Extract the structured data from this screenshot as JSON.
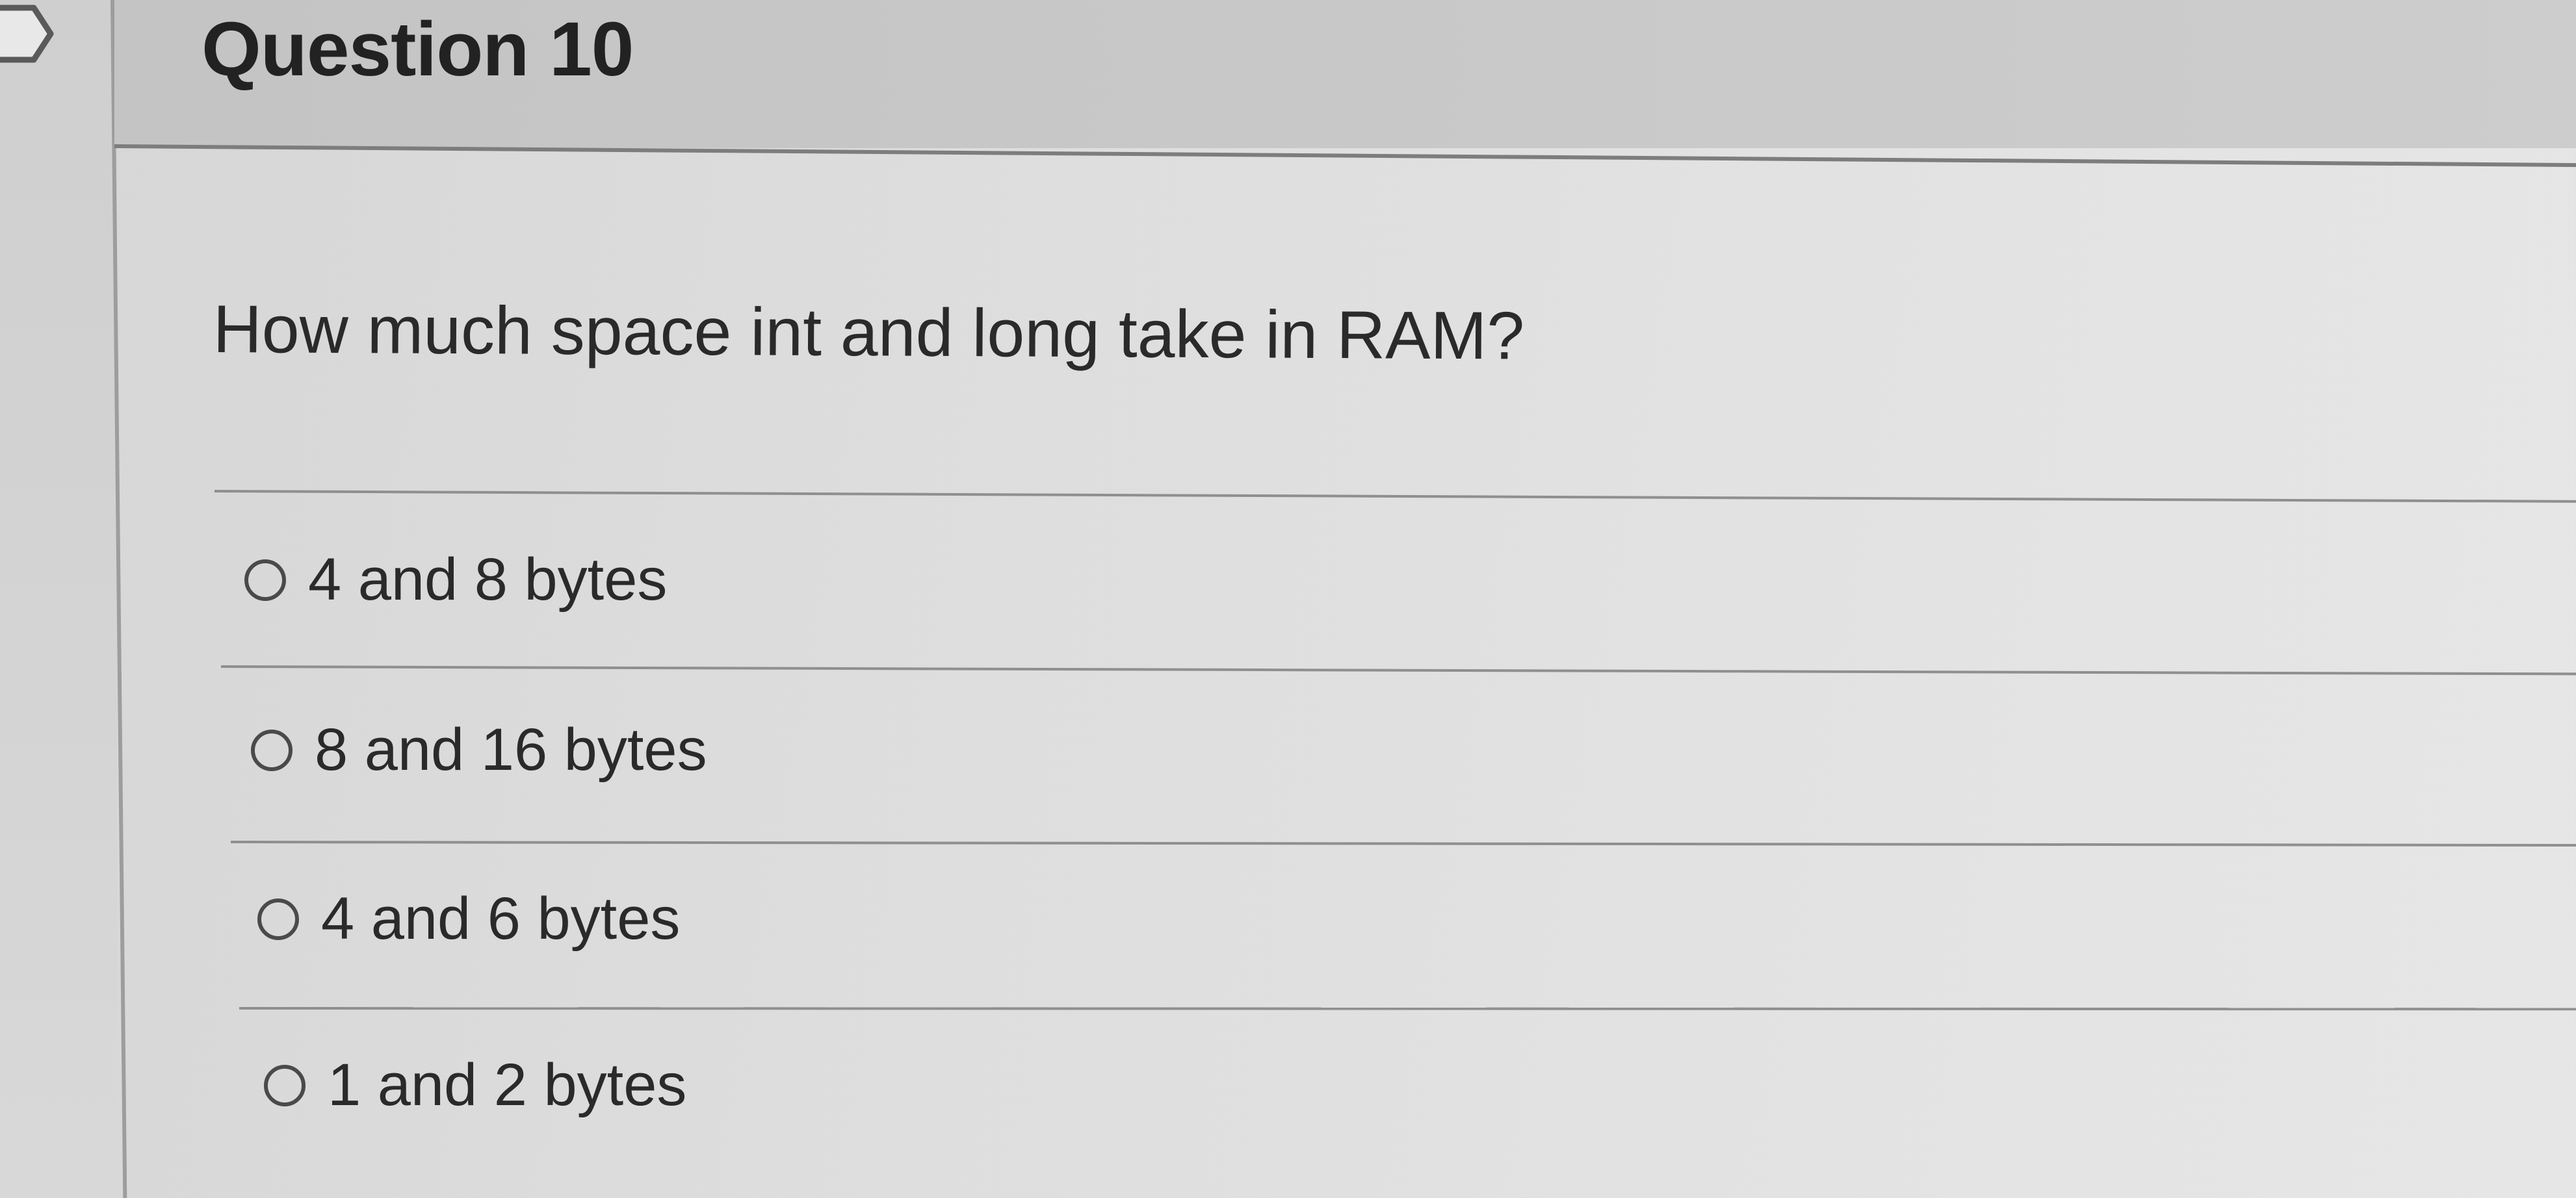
{
  "question": {
    "title": "Question 10",
    "text": "How much space int and long take in RAM?"
  },
  "answers": [
    {
      "label": "4 and 8 bytes",
      "selected": false
    },
    {
      "label": "8 and 16 bytes",
      "selected": false
    },
    {
      "label": "4 and 6 bytes",
      "selected": false
    },
    {
      "label": "1 and 2 bytes",
      "selected": false
    }
  ],
  "icons": {
    "flag": "flag-icon",
    "radio": "radio-unselected-icon"
  },
  "colors": {
    "header_bg": "#c8c8c8",
    "page_bg": "#dedede",
    "text": "#2a2a2a",
    "divider": "#8f8f8f"
  }
}
